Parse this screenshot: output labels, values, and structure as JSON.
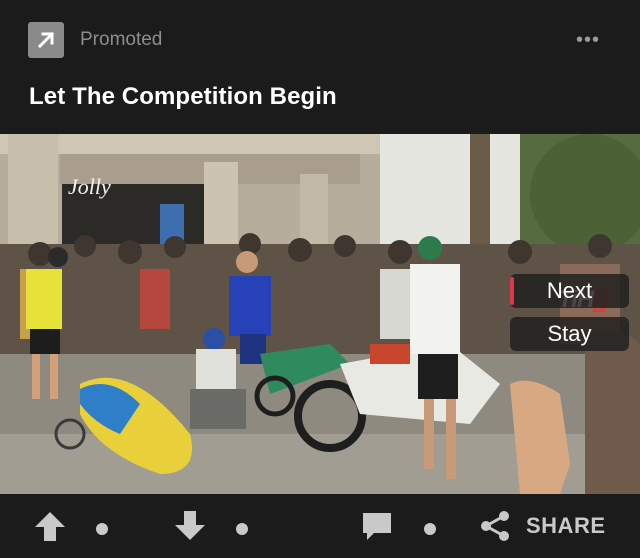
{
  "post": {
    "promoted_label": "Promoted",
    "title": "Let The Competition Begin"
  },
  "video": {
    "watermark_main": "TiH",
    "watermark_accent": "[]",
    "storefront_sign": "Jolly",
    "next_label": "Next",
    "stay_label": "Stay"
  },
  "actions": {
    "share_label": "SHARE"
  },
  "icons": {
    "promoted": "arrow-up-right-icon",
    "more": "more-dots-icon",
    "upvote": "arrow-up-icon",
    "downvote": "arrow-down-icon",
    "comment": "comment-icon",
    "share": "share-icon"
  },
  "colors": {
    "background": "#1b1b1b",
    "muted_text": "#8d8d8d",
    "icon": "#c9c9c9",
    "next_accent": "#e0364a"
  }
}
